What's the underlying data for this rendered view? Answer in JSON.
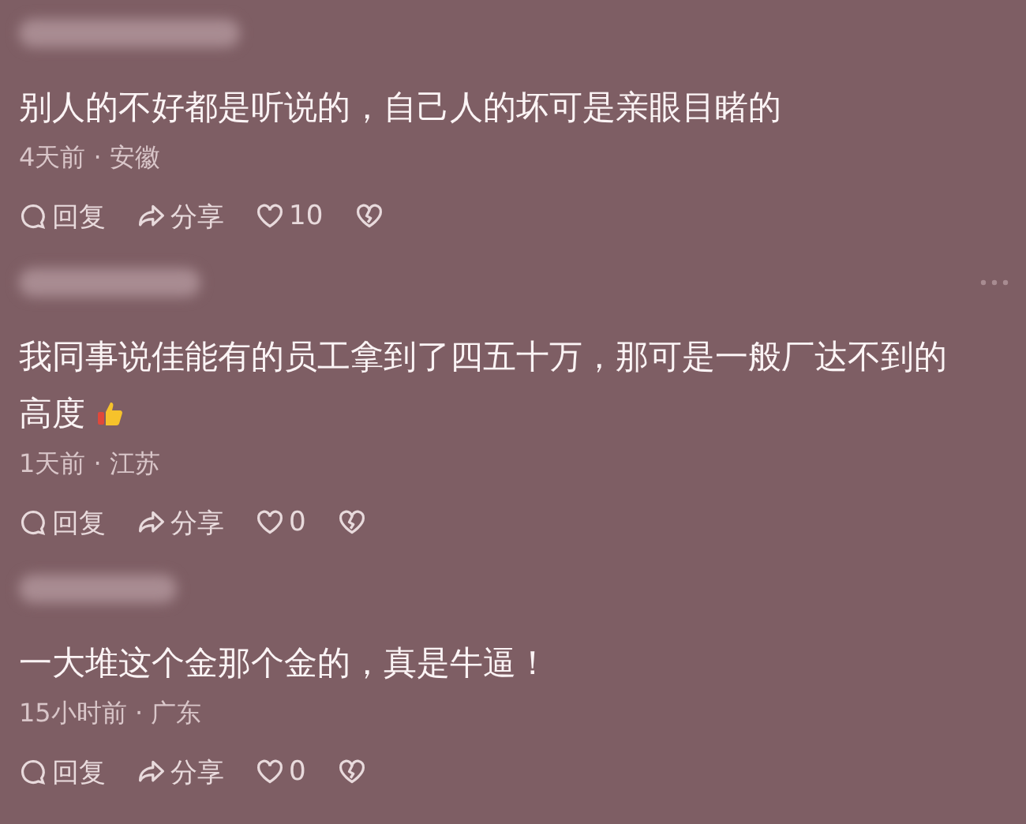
{
  "comments": [
    {
      "text": "别人的不好都是听说的，自己人的坏可是亲眼目睹的",
      "emoji": false,
      "more_menu": false,
      "time": "4天前",
      "separator": "·",
      "region": "安徽",
      "actions": {
        "reply": "回复",
        "share": "分享",
        "likes": "10"
      }
    },
    {
      "text": "我同事说佳能有的员工拿到了四五十万，那可是一般厂达不到的高度",
      "emoji": true,
      "more_menu": true,
      "time": "1天前",
      "separator": "·",
      "region": "江苏",
      "actions": {
        "reply": "回复",
        "share": "分享",
        "likes": "0"
      }
    },
    {
      "text": "一大堆这个金那个金的，真是牛逼！",
      "emoji": false,
      "more_menu": false,
      "time": "15小时前",
      "separator": "·",
      "region": "广东",
      "actions": {
        "reply": "回复",
        "share": "分享",
        "likes": "0"
      }
    }
  ]
}
